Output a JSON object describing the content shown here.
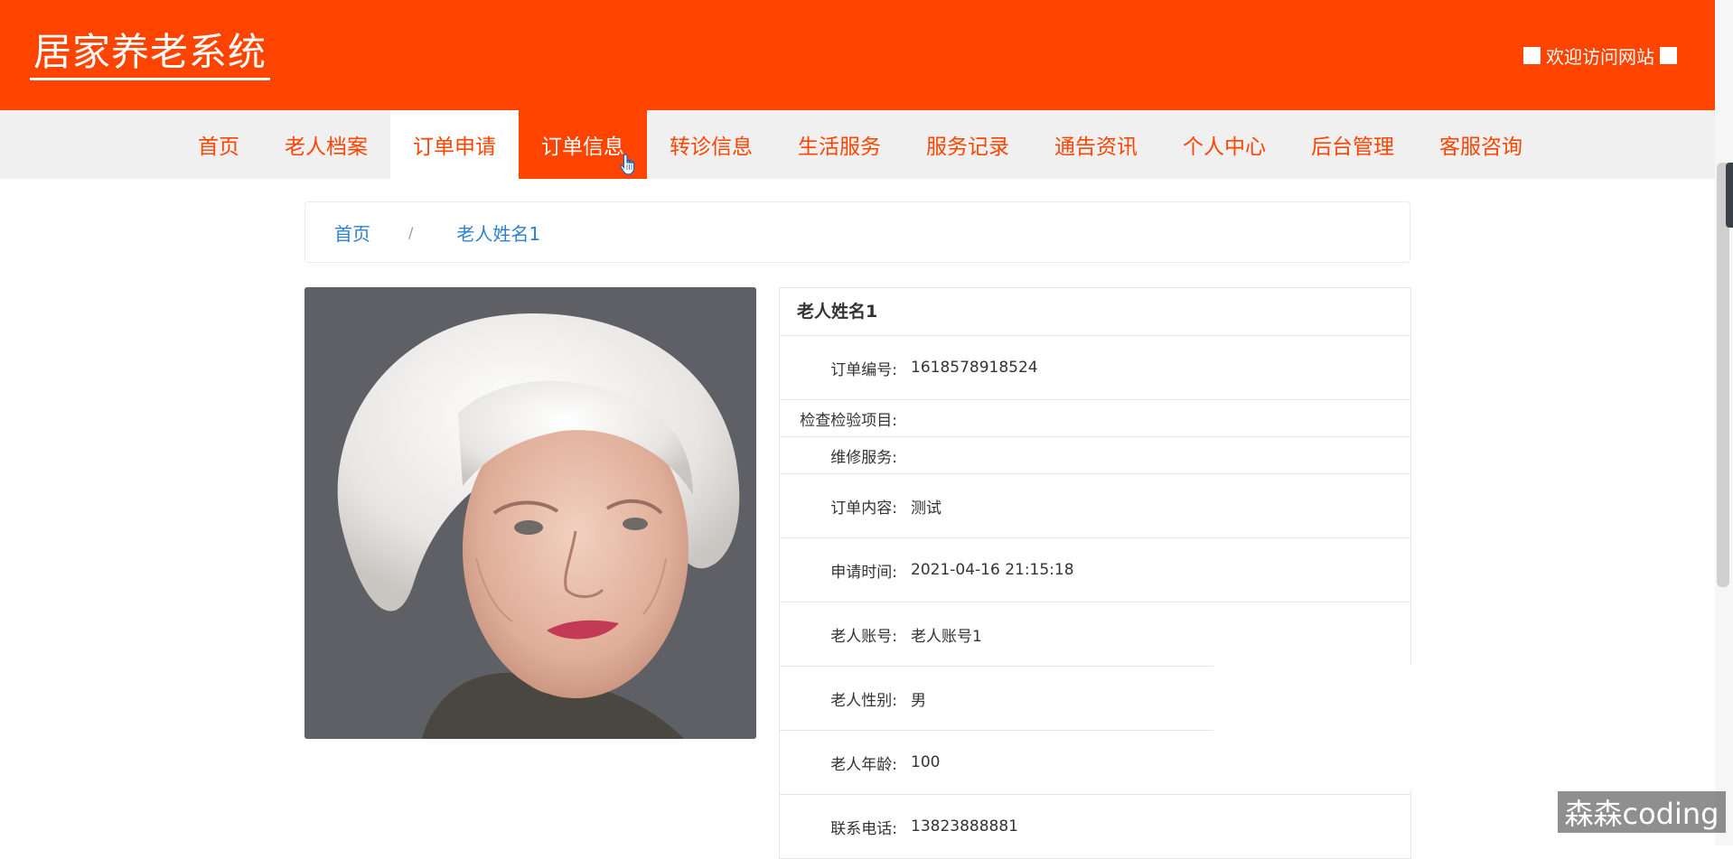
{
  "header": {
    "site_title": "居家养老系统",
    "welcome_text": "欢迎访问网站"
  },
  "nav": {
    "items": [
      {
        "label": "首页"
      },
      {
        "label": "老人档案"
      },
      {
        "label": "订单申请"
      },
      {
        "label": "订单信息"
      },
      {
        "label": "转诊信息"
      },
      {
        "label": "生活服务"
      },
      {
        "label": "服务记录"
      },
      {
        "label": "通告资讯"
      },
      {
        "label": "个人中心"
      },
      {
        "label": "后台管理"
      },
      {
        "label": "客服咨询"
      }
    ],
    "active": "订单信息"
  },
  "breadcrumb": {
    "home": "首页",
    "separator": "/",
    "current": "老人姓名1"
  },
  "detail": {
    "title": "老人姓名1",
    "fields": [
      {
        "label": "订单编号:",
        "value": "1618578918524"
      },
      {
        "label": "检查检验项目:",
        "value": ""
      },
      {
        "label": "维修服务:",
        "value": ""
      },
      {
        "label": "订单内容:",
        "value": "测试"
      },
      {
        "label": "申请时间:",
        "value": "2021-04-16 21:15:18"
      },
      {
        "label": "老人账号:",
        "value": "老人账号1"
      },
      {
        "label": "老人性别:",
        "value": "男"
      },
      {
        "label": "老人年龄:",
        "value": "100"
      },
      {
        "label": "联系电话:",
        "value": "13823888881"
      }
    ]
  },
  "watermark": "森森coding",
  "colors": {
    "brand": "#ff4400",
    "link": "#2e7fd4",
    "nav_bg": "#f0f0f0"
  }
}
